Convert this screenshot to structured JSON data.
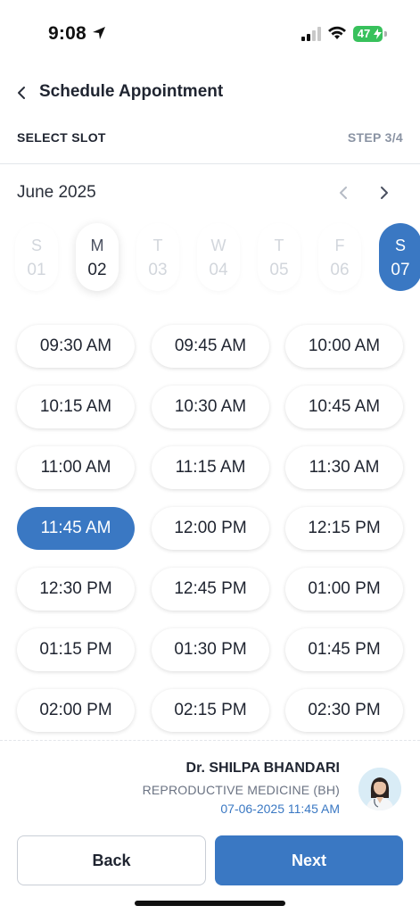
{
  "status_bar": {
    "time": "9:08",
    "battery": "47"
  },
  "header": {
    "title": "Schedule Appointment",
    "section_label": "SELECT SLOT",
    "step": "STEP 3/4"
  },
  "calendar": {
    "month": "June 2025",
    "days": [
      {
        "dow": "S",
        "num": "01",
        "state": "faded"
      },
      {
        "dow": "M",
        "num": "02",
        "state": "available"
      },
      {
        "dow": "T",
        "num": "03",
        "state": "faded"
      },
      {
        "dow": "W",
        "num": "04",
        "state": "faded"
      },
      {
        "dow": "T",
        "num": "05",
        "state": "faded"
      },
      {
        "dow": "F",
        "num": "06",
        "state": "faded"
      },
      {
        "dow": "S",
        "num": "07",
        "state": "selected"
      }
    ]
  },
  "slots": [
    "09:30 AM",
    "09:45 AM",
    "10:00 AM",
    "10:15 AM",
    "10:30 AM",
    "10:45 AM",
    "11:00 AM",
    "11:15 AM",
    "11:30 AM",
    "11:45 AM",
    "12:00 PM",
    "12:15 PM",
    "12:30 PM",
    "12:45 PM",
    "01:00 PM",
    "01:15 PM",
    "01:30 PM",
    "01:45 PM",
    "02:00 PM",
    "02:15 PM",
    "02:30 PM"
  ],
  "selected_slot": "11:45 AM",
  "doctor": {
    "name": "Dr. SHILPA BHANDARI",
    "specialty": "REPRODUCTIVE MEDICINE (BH)",
    "datetime": "07-06-2025 11:45 AM"
  },
  "buttons": {
    "back": "Back",
    "next": "Next"
  },
  "colors": {
    "accent": "#3a78c3",
    "text": "#1f2430",
    "muted": "#8a93a3"
  }
}
